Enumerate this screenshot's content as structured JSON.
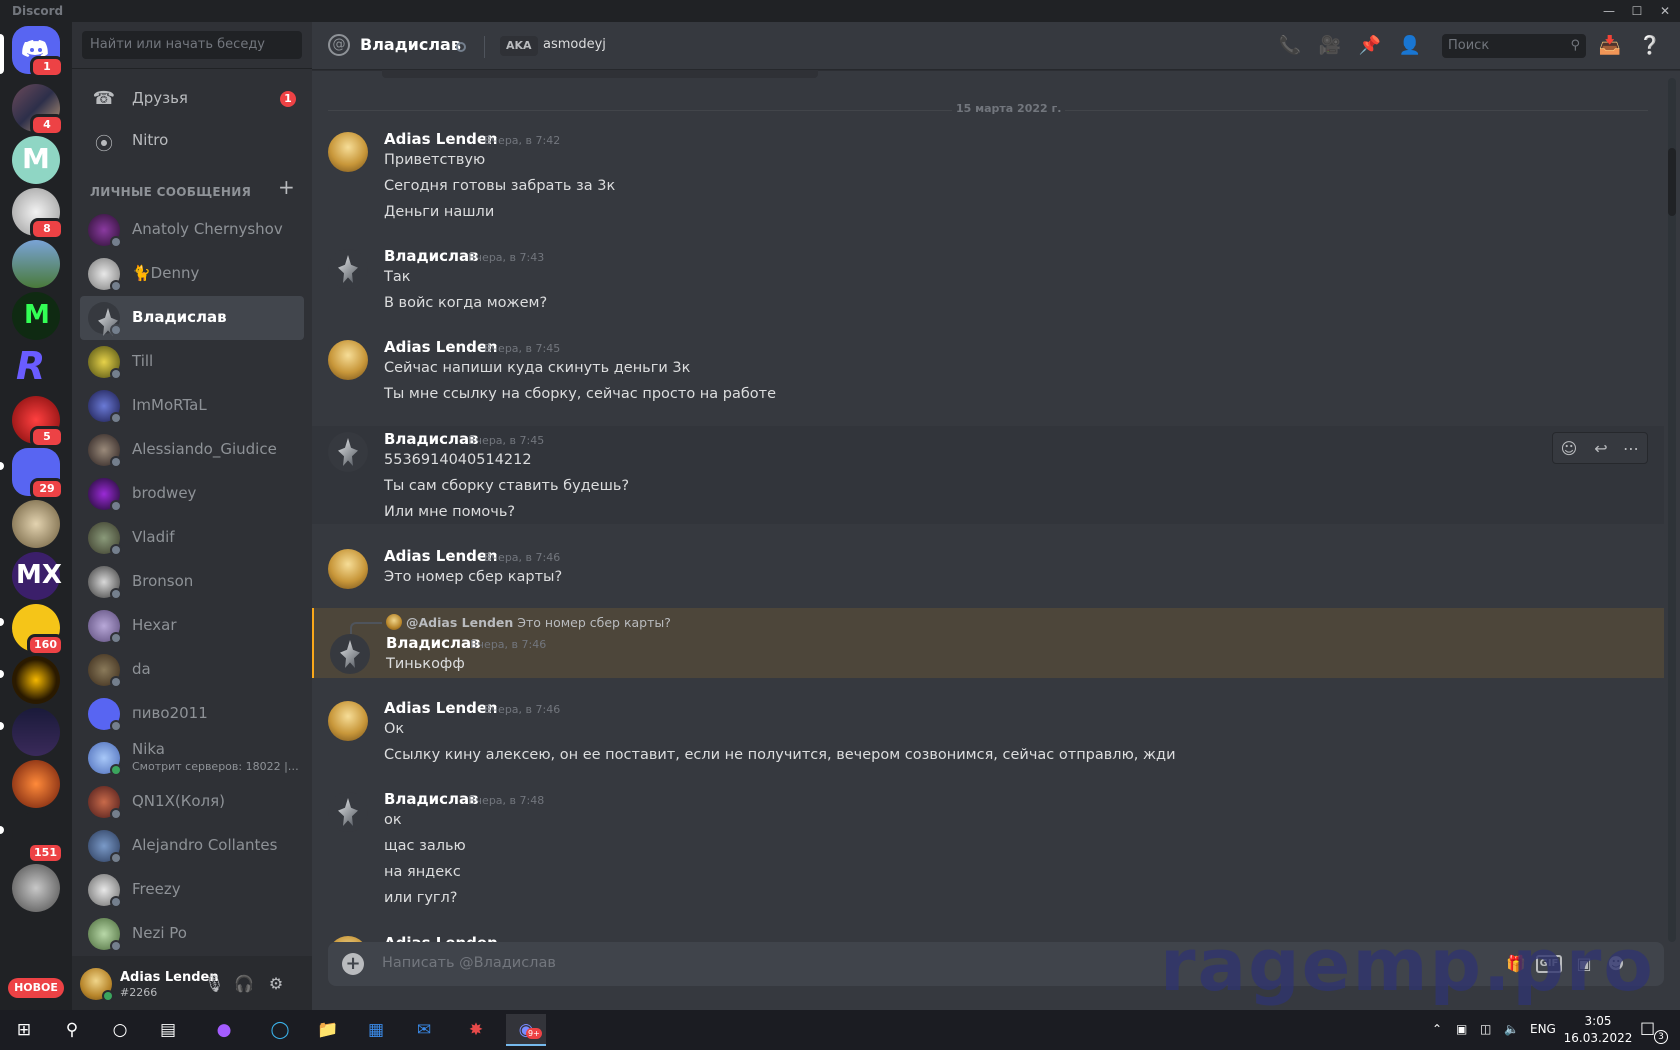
{
  "app": {
    "title": "Discord"
  },
  "colors": {
    "accent": "#5865f2",
    "mention_bar": "#faa81a",
    "badge": "#ed4245",
    "online": "#3ba55d"
  },
  "guilds": {
    "home_badge": "1",
    "items": [
      {
        "badge": "4"
      },
      {
        "badge": ""
      },
      {
        "badge": "8"
      },
      {
        "badge": ""
      },
      {
        "badge": ""
      },
      {
        "badge": ""
      },
      {
        "badge": "5"
      },
      {
        "badge": "29"
      },
      {
        "badge": ""
      },
      {
        "badge": ""
      },
      {
        "badge": "160"
      },
      {
        "badge": ""
      },
      {
        "badge": ""
      },
      {
        "badge": ""
      },
      {
        "badge": "151"
      },
      {
        "badge": ""
      }
    ],
    "new_label": "НОВОЕ"
  },
  "sidebar": {
    "search_placeholder": "Найти или начать беседу",
    "friends_label": "Друзья",
    "friends_badge": "1",
    "nitro_label": "Nitro",
    "dm_header": "ЛИЧНЫЕ СООБЩЕНИЯ",
    "dms": [
      {
        "name": "Anatoly Chernyshov",
        "sub": ""
      },
      {
        "name": "🐈Denny",
        "sub": ""
      },
      {
        "name": "Владислав",
        "sub": ""
      },
      {
        "name": "Till",
        "sub": ""
      },
      {
        "name": "ImMoRTaL",
        "sub": ""
      },
      {
        "name": "Alessiando_Giudice",
        "sub": ""
      },
      {
        "name": "brodwey",
        "sub": ""
      },
      {
        "name": "Vladif",
        "sub": ""
      },
      {
        "name": "Bronson",
        "sub": ""
      },
      {
        "name": "Hexar",
        "sub": ""
      },
      {
        "name": "da",
        "sub": ""
      },
      {
        "name": "пиво2011",
        "sub": ""
      },
      {
        "name": "Nika",
        "sub": "Смотрит серверов: 18022 | /..."
      },
      {
        "name": "QN1X(Коля)",
        "sub": ""
      },
      {
        "name": "Alejandro Collantes",
        "sub": ""
      },
      {
        "name": "Freezy",
        "sub": ""
      },
      {
        "name": "Nezi Po",
        "sub": ""
      }
    ]
  },
  "user": {
    "name": "Adias Lenden",
    "tag": "#2266"
  },
  "header": {
    "title": "Владислав",
    "aka_label": "AKA",
    "aka_name": "asmodeyj",
    "search_placeholder": "Поиск"
  },
  "date_divider": "15 марта 2022 г.",
  "messages": [
    {
      "author": "Adias Lenden",
      "time": "Вчера, в 7:42",
      "lines": [
        "Приветствую",
        "Сегодня готовы забрать за 3к",
        "Деньги нашли"
      ]
    },
    {
      "author": "Владислав",
      "time": "Вчера, в 7:43",
      "lines": [
        "Так",
        "В войс когда можем?"
      ]
    },
    {
      "author": "Adias Lenden",
      "time": "Вчера, в 7:45",
      "lines": [
        "Сейчас напиши куда скинуть деньги 3к",
        "Ты мне ссылку на сборку, сейчас просто на работе"
      ]
    },
    {
      "author": "Владислав",
      "time": "Вчера, в 7:45",
      "lines": [
        "5536914040514212",
        "Ты сам сборку ставить будешь?",
        "Или мне помочь?"
      ]
    },
    {
      "author": "Adias Lenden",
      "time": "Вчера, в 7:46",
      "lines": [
        "Это номер сбер карты?"
      ]
    },
    {
      "author": "Владислав",
      "time": "Вчера, в 7:46",
      "reply_to": "@Adias Lenden",
      "reply_text": "Это номер сбер карты?",
      "lines": [
        "Тинькофф"
      ]
    },
    {
      "author": "Adias Lenden",
      "time": "Вчера, в 7:46",
      "lines": [
        "Ок",
        "Ссылку кину алексею, он ее поставит, если не получится, вечером созвонимся, сейчас отправлю, жди"
      ]
    },
    {
      "author": "Владислав",
      "time": "Вчера, в 7:48",
      "lines": [
        "ок",
        "щас залью",
        "на яндекс",
        "или гугл?"
      ]
    },
    {
      "author": "Adias Lenden",
      "time": "",
      "lines": []
    }
  ],
  "composer": {
    "placeholder": "Написать @Владислав",
    "gif_label": "GIF"
  },
  "watermark": "ragemp.pro",
  "taskbar": {
    "lang": "ENG",
    "time": "3:05",
    "date": "16.03.2022",
    "notif_count": "3",
    "discord_badge": "9+"
  }
}
